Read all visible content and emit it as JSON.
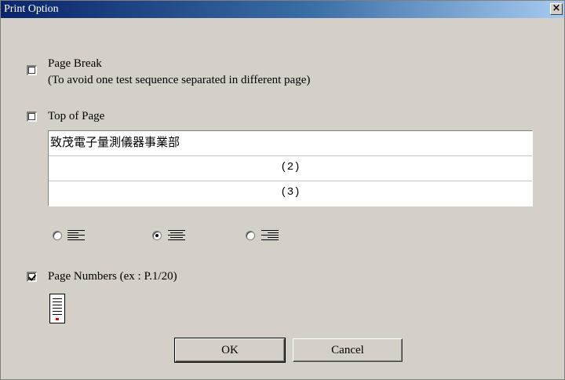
{
  "window": {
    "title": "Print Option",
    "close_icon": "close-icon"
  },
  "page_break": {
    "checked": false,
    "label": "Page Break",
    "note": "(To avoid one test sequence separated in different page)"
  },
  "top_of_page": {
    "checked": false,
    "label": "Top of Page",
    "header_lines": [
      "致茂電子量測儀器事業部",
      "(2)",
      "(3)"
    ]
  },
  "alignment": {
    "options": [
      "left",
      "center",
      "right"
    ],
    "selected": "center"
  },
  "page_numbers": {
    "checked": true,
    "label": "Page Numbers (ex : P.1/20)",
    "icon": "page-number-preview-icon"
  },
  "buttons": {
    "ok": "OK",
    "cancel": "Cancel"
  }
}
